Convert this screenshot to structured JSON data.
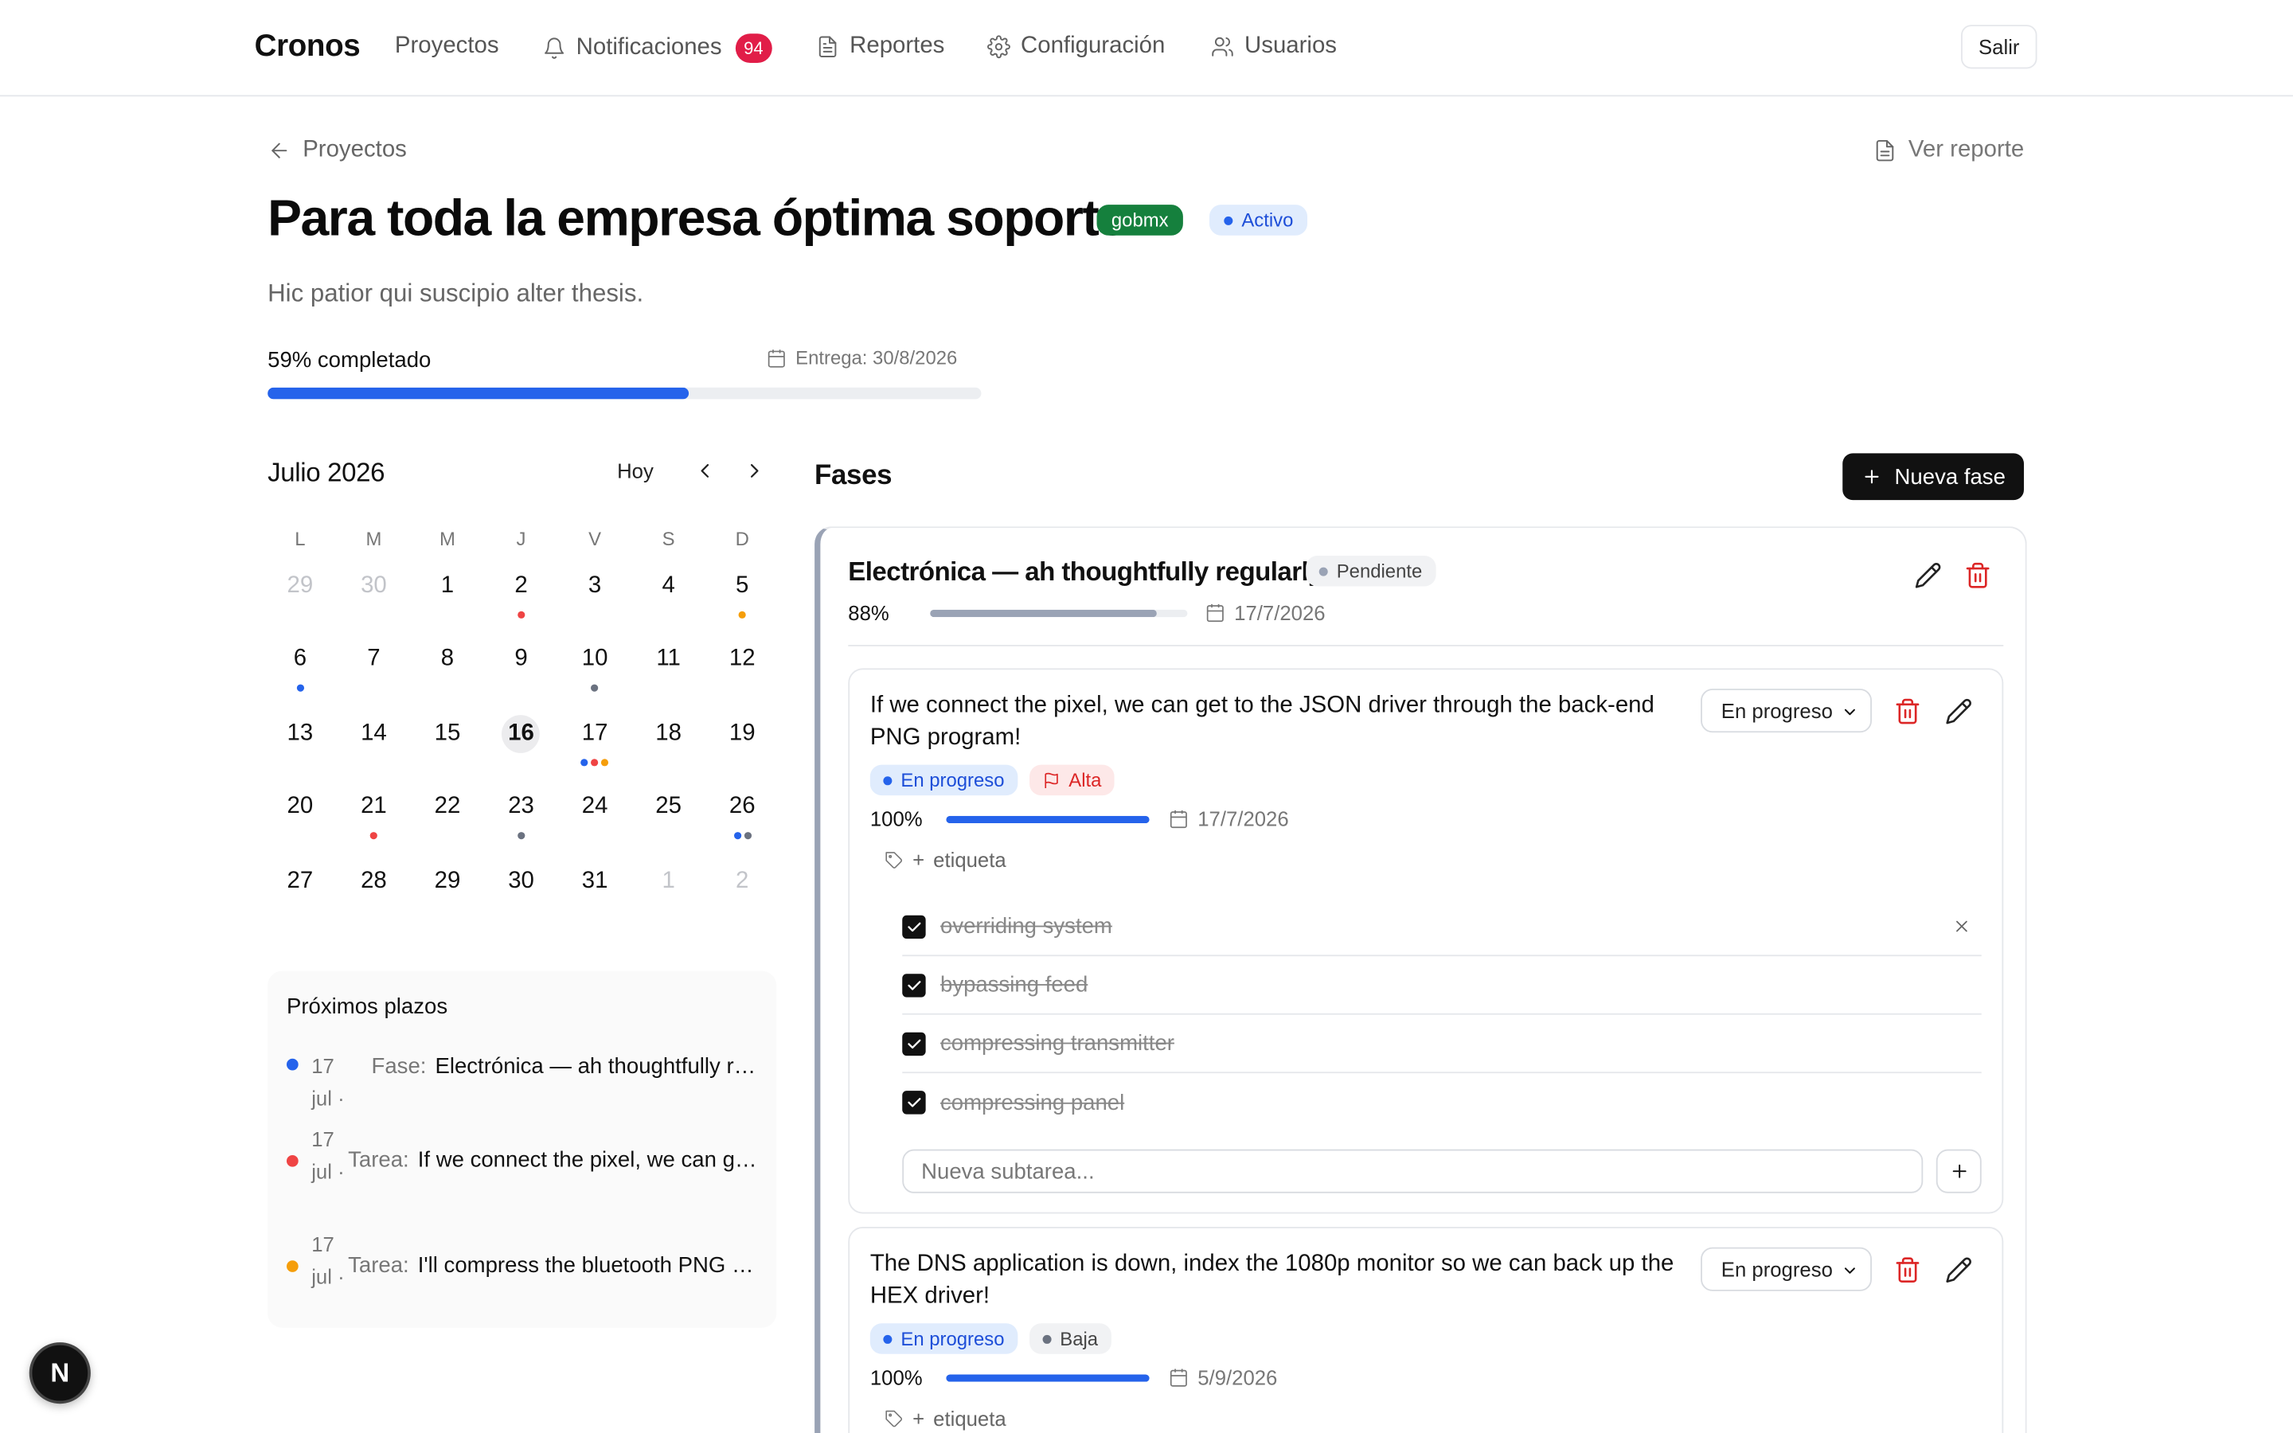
{
  "nav": {
    "brand": "Cronos",
    "projects": "Proyectos",
    "notifications": "Notificaciones",
    "notifications_count": "94",
    "reports": "Reportes",
    "settings": "Configuración",
    "users": "Usuarios",
    "logout": "Salir"
  },
  "header": {
    "back": "Proyectos",
    "view_report": "Ver reporte",
    "title": "Para toda la empresa óptima soporte",
    "org_tag": "gobmx",
    "status": "Activo",
    "description": "Hic patior qui suscipio alter thesis.",
    "progress_label": "59% completado",
    "progress": 0.59,
    "due": "Entrega: 30/8/2026"
  },
  "calendar": {
    "month": "Julio 2026",
    "today_label": "Hoy",
    "weekdays": [
      "L",
      "M",
      "M",
      "J",
      "V",
      "S",
      "D"
    ],
    "days": [
      {
        "n": "29",
        "other": true
      },
      {
        "n": "30",
        "other": true
      },
      {
        "n": "1"
      },
      {
        "n": "2",
        "dots": [
          "#ef4444"
        ]
      },
      {
        "n": "3"
      },
      {
        "n": "4"
      },
      {
        "n": "5",
        "dots": [
          "#f59e0b"
        ]
      },
      {
        "n": "6",
        "dots": [
          "#2563eb"
        ]
      },
      {
        "n": "7"
      },
      {
        "n": "8"
      },
      {
        "n": "9"
      },
      {
        "n": "10",
        "dots": [
          "#6b7280"
        ]
      },
      {
        "n": "11"
      },
      {
        "n": "12"
      },
      {
        "n": "13"
      },
      {
        "n": "14"
      },
      {
        "n": "15"
      },
      {
        "n": "16",
        "today": true
      },
      {
        "n": "17",
        "dots": [
          "#2563eb",
          "#ef4444",
          "#f59e0b"
        ]
      },
      {
        "n": "18"
      },
      {
        "n": "19"
      },
      {
        "n": "20"
      },
      {
        "n": "21",
        "dots": [
          "#ef4444"
        ]
      },
      {
        "n": "22"
      },
      {
        "n": "23",
        "dots": [
          "#6b7280"
        ]
      },
      {
        "n": "24"
      },
      {
        "n": "25"
      },
      {
        "n": "26",
        "dots": [
          "#2563eb",
          "#6b7280"
        ]
      },
      {
        "n": "27"
      },
      {
        "n": "28"
      },
      {
        "n": "29"
      },
      {
        "n": "30"
      },
      {
        "n": "31"
      },
      {
        "n": "1",
        "other": true
      },
      {
        "n": "2",
        "other": true
      }
    ]
  },
  "deadlines": {
    "title": "Próximos plazos",
    "items": [
      {
        "date": "17 jul ·",
        "kind": "Fase:",
        "title": "Electrónica — ah thoughtfully regularly",
        "color": "#2563eb"
      },
      {
        "date": "17 jul ·",
        "kind": "Tarea:",
        "title": "If we connect the pixel, we can get to the JSON driver",
        "color": "#ef4444"
      },
      {
        "date": "17 jul ·",
        "kind": "Tarea:",
        "title": "I'll compress the bluetooth PNG card",
        "color": "#f59e0b"
      }
    ]
  },
  "phases": {
    "title": "Fases",
    "new_phase": "Nueva fase",
    "items": [
      {
        "title": "Electrónica — ah thoughtfully regularly",
        "status": "Pendiente",
        "pct": "88%",
        "progress": 0.88,
        "date": "17/7/2026",
        "tasks": [
          {
            "title": "If we connect the pixel, we can get to the JSON driver through the back-end PNG program!",
            "status_select": "En progreso",
            "status": "En progreso",
            "priority": "Alta",
            "pct": "100%",
            "progress": 1.0,
            "date": "17/7/2026",
            "tag_add": "etiqueta",
            "subtasks": [
              "overriding system",
              "bypassing feed",
              "compressing transmitter",
              "compressing panel"
            ],
            "subtask_placeholder": "Nueva subtarea..."
          },
          {
            "title": "The DNS application is down, index the 1080p monitor so we can back up the HEX driver!",
            "status_select": "En progreso",
            "status": "En progreso",
            "priority": "Baja",
            "pct": "100%",
            "progress": 1.0,
            "date": "5/9/2026",
            "tag_add": "etiqueta"
          }
        ]
      }
    ]
  },
  "next_badge": "N",
  "colors": {
    "primary": "#2563eb",
    "danger": "#dc2626",
    "org": "#15803d",
    "phase_bar": "#9aa3b5"
  }
}
